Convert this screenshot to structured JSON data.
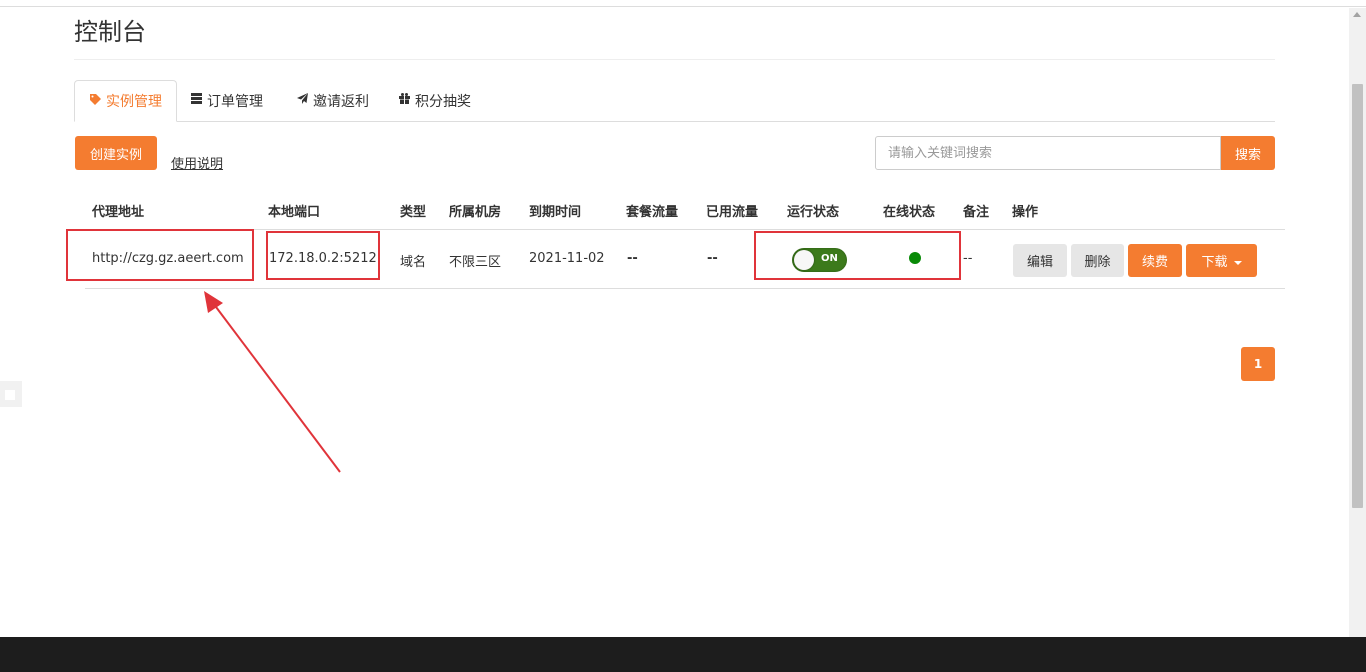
{
  "page": {
    "title": "控制台"
  },
  "tabs": [
    {
      "label": "实例管理",
      "icon": "tag-icon",
      "active": true
    },
    {
      "label": "订单管理",
      "icon": "server-icon"
    },
    {
      "label": "邀请返利",
      "icon": "paper-plane-icon"
    },
    {
      "label": "积分抽奖",
      "icon": "gift-icon"
    }
  ],
  "toolbar": {
    "create_label": "创建实例",
    "help_label": "使用说明",
    "search_placeholder": "请输入关键词搜索",
    "search_label": "搜索"
  },
  "table": {
    "headers": [
      "代理地址",
      "本地端口",
      "类型",
      "所属机房",
      "到期时间",
      "套餐流量",
      "已用流量",
      "运行状态",
      "在线状态",
      "备注",
      "操作"
    ],
    "rows": [
      {
        "address": "http://czg.gz.aeert.com",
        "port": "172.18.0.2:5212",
        "type": "域名",
        "room": "不限三区",
        "expire": "2021-11-02",
        "plan_traffic": "--",
        "used_traffic": "--",
        "run_status": "ON",
        "online": true,
        "note": "--"
      }
    ],
    "actions": {
      "edit": "编辑",
      "delete": "删除",
      "renew": "续费",
      "download": "下载"
    }
  },
  "pagination": {
    "current": "1"
  },
  "colors": {
    "accent": "#f47c30",
    "online": "#098a07",
    "toggle_on": "#3c7a1b",
    "annotation": "#e0343a"
  }
}
